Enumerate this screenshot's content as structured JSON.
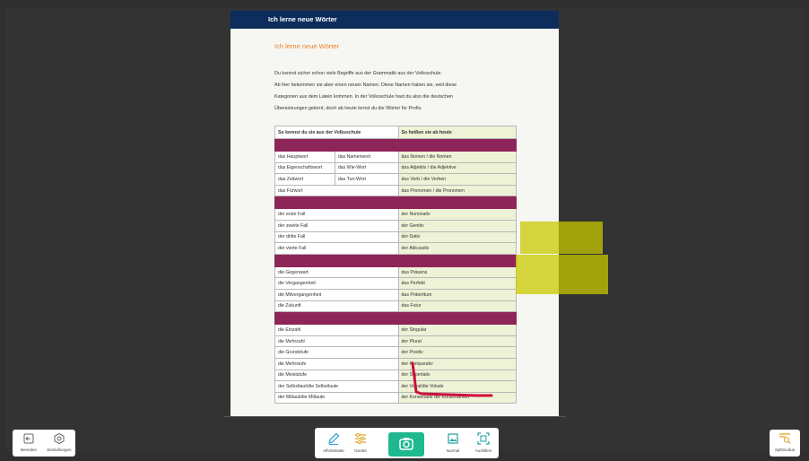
{
  "document": {
    "header_title": "Ich lerne neue Wörter",
    "heading": "Ich lerne neue Wörter",
    "intro_lines": [
      "Du kennst sicher schon viele Begriffe aus der Grammatik aus der Volksschule.",
      "Ab hier bekommen sie aber einen neuen Namen. Diese Namen haben sie, weil diese",
      "Kategorien aus dem Latein kommen. In der Volksschule hast du also die deutschen",
      "Übersetzungen gelernt, doch ab heute lernst du die Wörter für Profis."
    ],
    "table": {
      "headers": [
        "So kennst du sie aus der Volksschule",
        "So heißen sie ab heute"
      ],
      "rows": [
        [
          "das Hauptwort",
          "das Namenwort",
          "das Nomen / die Nomen"
        ],
        [
          "das Eigenschaftswort",
          "das Wie-Wort",
          "das Adjektiv / die Adjektive"
        ],
        [
          "das Zeitwort",
          "das Tun-Wort",
          "das Verb / die Verben"
        ],
        [
          "das Fürwort",
          "",
          "das Pronomen / die Pronomen"
        ],
        [
          "der erste Fall",
          "",
          "der Nominativ"
        ],
        [
          "der zweite Fall",
          "",
          "der Genitiv"
        ],
        [
          "der dritte Fall",
          "",
          "der Dativ"
        ],
        [
          "der vierte Fall",
          "",
          "der Akkusativ"
        ],
        [
          "die Gegenwart",
          "",
          "das Präsens"
        ],
        [
          "die Vergangenheit",
          "",
          "das Perfekt"
        ],
        [
          "die Mitvergangenheit",
          "",
          "das Präteritum"
        ],
        [
          "die Zukunft",
          "",
          "das Futur"
        ],
        [
          "die Einzahl",
          "",
          "der Singular"
        ],
        [
          "die Mehrzahl",
          "",
          "der Plural"
        ],
        [
          "die Grundstufe",
          "",
          "der Positiv"
        ],
        [
          "die Mehrstufe",
          "",
          "der Komparativ"
        ],
        [
          "die Meiststufe",
          "",
          "der Superlativ"
        ],
        [
          "der Selbstlaut/die Selbstlaute",
          "",
          "der Vokal/die Vokale"
        ],
        [
          "der Mitlaut/die Mitlaute",
          "",
          "der Konsonant/ die Konsonanten"
        ]
      ]
    }
  },
  "toolbar": {
    "left": [
      {
        "label": "Beenden",
        "icon": "exit-icon"
      },
      {
        "label": "Einstellungen",
        "icon": "settings-icon"
      }
    ],
    "center": [
      {
        "label": "AllViMintate",
        "icon": "pen-icon"
      },
      {
        "label": "Geräte",
        "icon": "sliders-icon"
      },
      {
        "label": "",
        "icon": "camera-icon"
      },
      {
        "label": "Normal",
        "icon": "image-icon"
      },
      {
        "label": "Ausfüllen",
        "icon": "fill-frame-icon"
      }
    ],
    "right": [
      {
        "label": "Splitmodus",
        "icon": "split-mode-icon"
      }
    ]
  },
  "colors": {
    "background": "#2f2f2f",
    "doc_header": "#0d2d5c",
    "heading_orange": "#e8832a",
    "table_band": "#8e2558",
    "right_column": "#eef2d6",
    "highlight_yellow": "#c8c800",
    "pen_red": "#d0103a",
    "camera_green": "#1fb88f",
    "accent_icon": "#e0a020"
  }
}
